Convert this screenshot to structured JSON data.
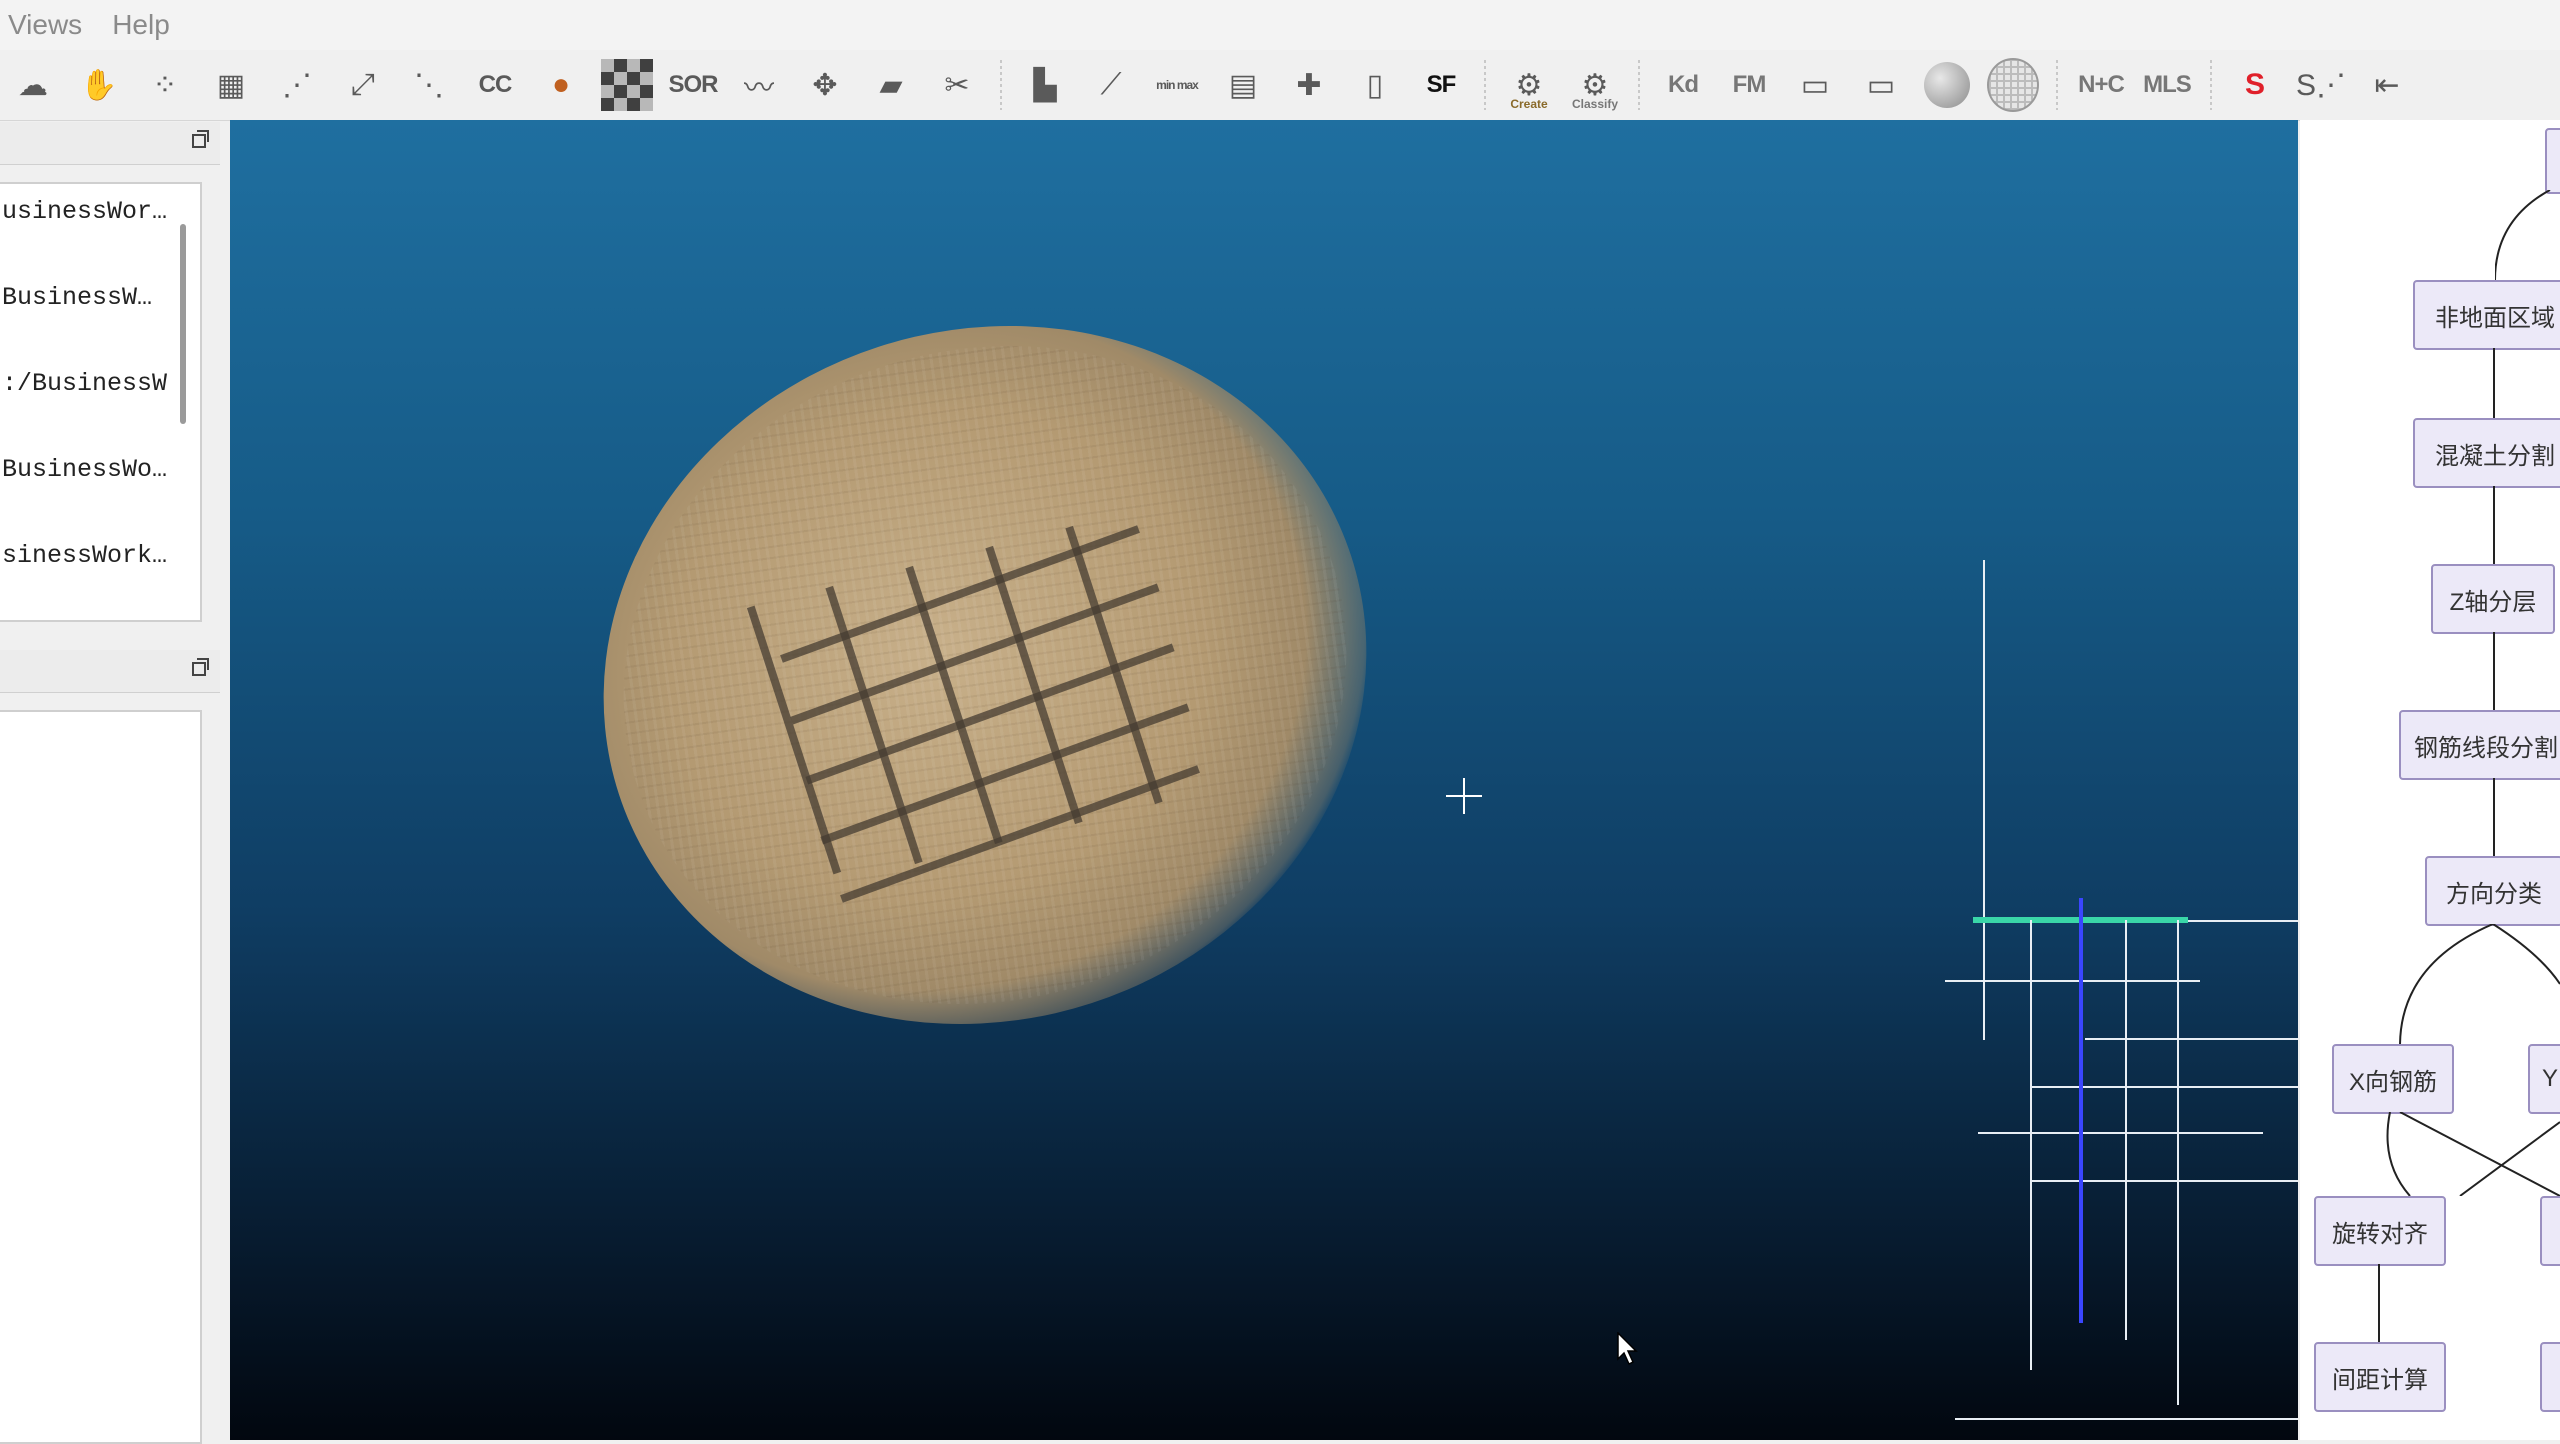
{
  "menubar": {
    "items": [
      "Views",
      "Help"
    ]
  },
  "toolbar": {
    "icons": [
      "clouds-icon",
      "segment-icon",
      "sample-icon",
      "noise-icon",
      "scatter-icon",
      "register-icon",
      "points-icon",
      "cc-icon",
      "bucket-icon",
      "checker-icon",
      "sor-icon",
      "curve-icon",
      "move-icon",
      "plane-icon",
      "pin-icon",
      "histogram-icon",
      "chart-icon",
      "minmax-icon",
      "calendar-icon",
      "plus-icon",
      "clipboard-icon",
      "sf-icon",
      "canupo-create-icon",
      "canupo-classify-icon",
      "kd-icon",
      "fm-icon",
      "dip-icon",
      "dev-icon",
      "sphere-icon",
      "grid-sphere-icon",
      "nc-icon",
      "mls-icon",
      "s-icon",
      "s-points-icon",
      "export-icon"
    ],
    "labels": {
      "cc": "CC",
      "sor": "SOR",
      "sf": "SF",
      "canupo_create": "Create",
      "canupo_classify": "Classify",
      "kd": "Kd",
      "fm": "FM",
      "nc": "N+C",
      "mls": "MLS",
      "minmax": "min max"
    }
  },
  "db_tree": {
    "rows": [
      "usinessWor…",
      "BusinessW…",
      ":/BusinessW",
      "BusinessWo…",
      "sinessWork…"
    ]
  },
  "flowchart": {
    "boxes": [
      "非地面区域",
      "混凝土分割",
      "Z轴分层",
      "钢筋线段分割",
      "方向分类",
      "X向钢筋",
      "Y",
      "旋转对齐",
      "间距计算"
    ]
  },
  "colors": {
    "accent": "#9a8fc0",
    "view_top": "#1f6fa0",
    "view_bottom": "#02070f"
  }
}
